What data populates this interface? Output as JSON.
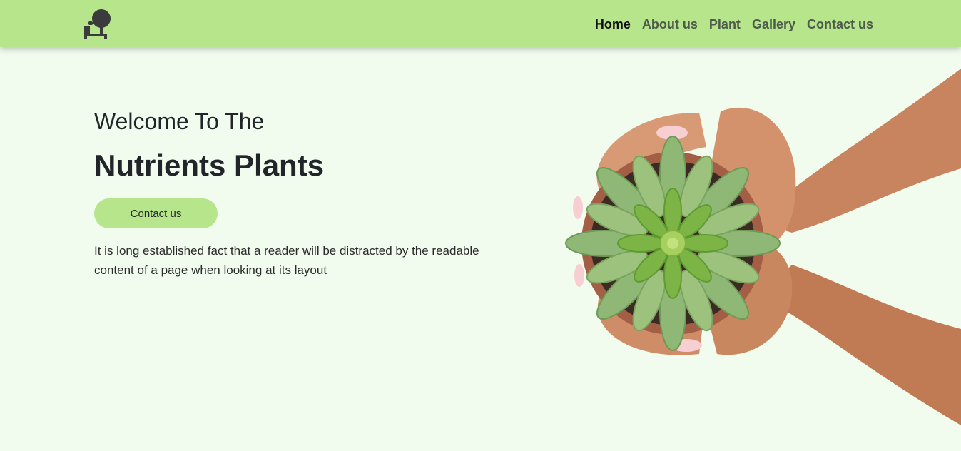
{
  "nav": {
    "logo_icon": "tree-bench-icon",
    "links": [
      {
        "label": "Home",
        "active": true
      },
      {
        "label": "About us",
        "active": false
      },
      {
        "label": "Plant",
        "active": false
      },
      {
        "label": "Gallery",
        "active": false
      },
      {
        "label": "Contact us",
        "active": false
      }
    ]
  },
  "hero": {
    "welcome": "Welcome To The",
    "title": "Nutrients Plants",
    "cta_label": "Contact us",
    "description": "It is long established fact that a reader will be distracted by the readable content of a page when looking at its layout",
    "image": "hands-holding-succulent-pot-image"
  },
  "colors": {
    "nav_bg": "#b6e58b",
    "page_bg": "#f1fbee",
    "button_bg": "#b6e58b",
    "link_color": "#4d5a49",
    "active_link": "#111111"
  }
}
